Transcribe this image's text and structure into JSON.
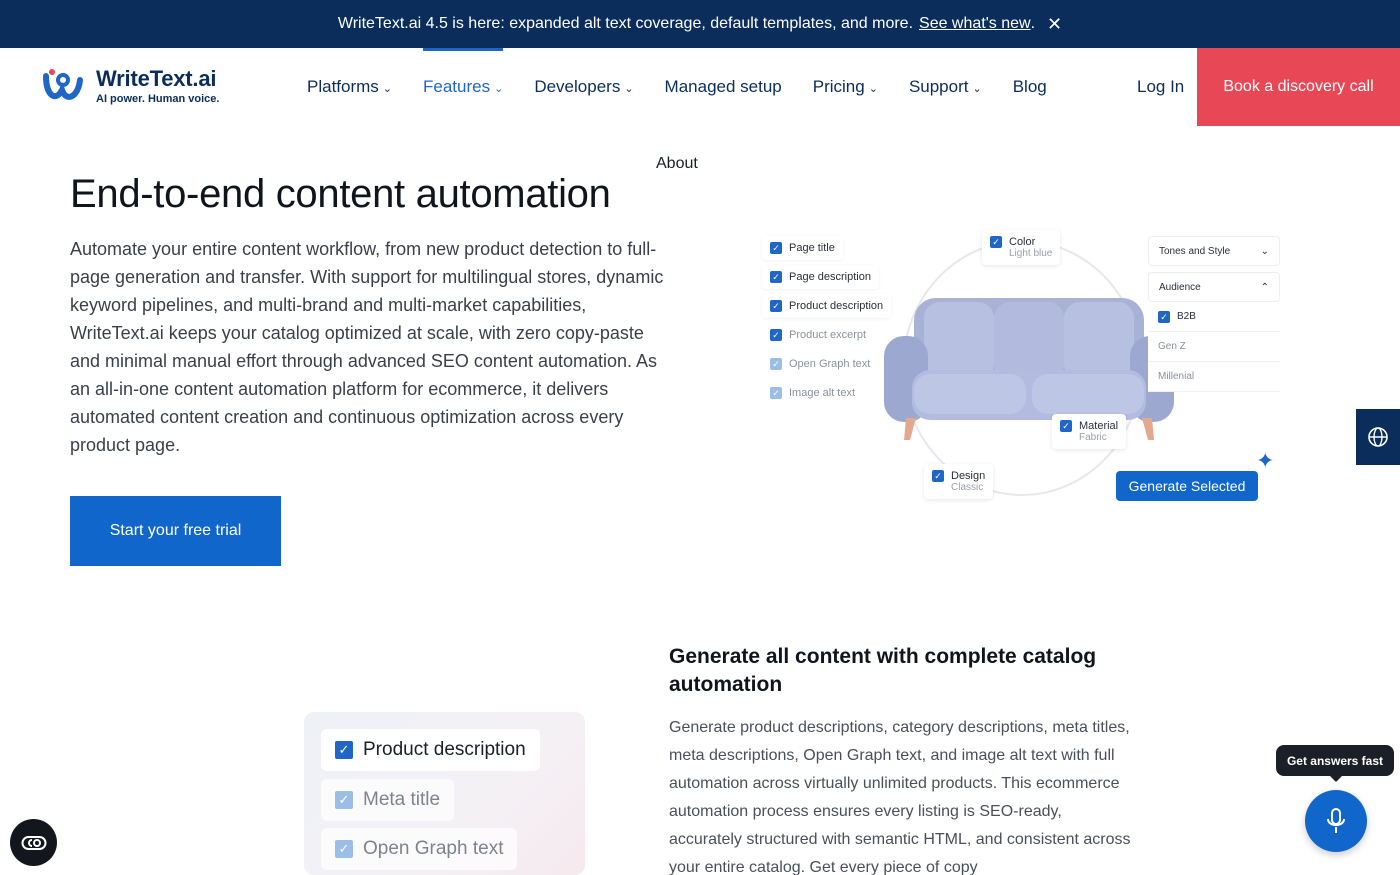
{
  "announcement": {
    "text": "WriteText.ai 4.5 is here: expanded alt text coverage, default templates, and more.",
    "link": "See what's new",
    "link_suffix": ".",
    "close_icon": "close-icon"
  },
  "header": {
    "brand_name": "WriteText.ai",
    "brand_tagline": "AI power. Human voice.",
    "nav": [
      {
        "label": "Platforms",
        "dropdown": true
      },
      {
        "label": "Features",
        "dropdown": true,
        "active": true
      },
      {
        "label": "Developers",
        "dropdown": true
      },
      {
        "label": "Managed setup",
        "dropdown": false
      },
      {
        "label": "Pricing",
        "dropdown": true
      },
      {
        "label": "Support",
        "dropdown": true
      },
      {
        "label": "Blog",
        "dropdown": false
      }
    ],
    "about_label": "About",
    "login_label": "Log In",
    "cta_label": "Book a discovery call"
  },
  "hero": {
    "title": "End-to-end content automation",
    "body": "Automate your entire content workflow, from new product detection to full-page generation and transfer. With support for multilingual stores, dynamic keyword pipelines, and multi-brand and multi-market capabilities, WriteText.ai keeps your catalog optimized at scale, with zero copy-paste and minimal manual effort through advanced SEO content automation. As an all-in-one content automation platform for ecommerce, it delivers automated content creation and continuous optimization across every product page.",
    "cta_label": "Start your free trial"
  },
  "illustration": {
    "checklist": [
      "Page title",
      "Page description",
      "Product description",
      "Product excerpt",
      "Open Graph text",
      "Image alt text"
    ],
    "color_card": {
      "label": "Color",
      "value": "Light blue"
    },
    "material_card": {
      "label": "Material",
      "value": "Fabric"
    },
    "design_card": {
      "label": "Design",
      "value": "Classic"
    },
    "tones_label": "Tones and Style",
    "audience_label": "Audience",
    "audience_options": [
      "B2B",
      "Gen Z",
      "Millenial"
    ],
    "generate_label": "Generate Selected"
  },
  "section2": {
    "title": "Generate all content with complete catalog automation",
    "body": "Generate product descriptions, category descriptions, meta titles, meta descriptions, Open Graph text, and image alt text with full automation across virtually unlimited products.  This ecommerce automation process ensures every listing is SEO-ready, accurately structured with semantic HTML, and consistent across your entire catalog. Get every piece of copy",
    "items": [
      "Product description",
      "Meta title",
      "Open Graph text"
    ]
  },
  "floating": {
    "answers_label": "Get answers fast",
    "mic_icon": "microphone-icon",
    "globe_icon": "globe-icon",
    "accessibility_icon": "accessibility-icon"
  },
  "colors": {
    "navy": "#0b2d5b",
    "accent_blue": "#1166cc",
    "cta_red": "#e84855"
  }
}
